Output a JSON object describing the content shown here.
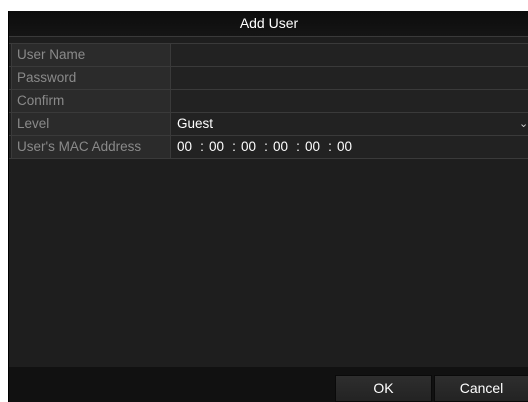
{
  "dialog": {
    "title": "Add User"
  },
  "form": {
    "user_name": {
      "label": "User Name",
      "value": ""
    },
    "password": {
      "label": "Password",
      "value": ""
    },
    "confirm": {
      "label": "Confirm",
      "value": ""
    },
    "level": {
      "label": "Level",
      "value": "Guest"
    },
    "mac": {
      "label": "User's MAC Address",
      "segments": [
        "00",
        "00",
        "00",
        "00",
        "00",
        "00"
      ],
      "separator": ":"
    }
  },
  "buttons": {
    "ok": "OK",
    "cancel": "Cancel"
  },
  "colors": {
    "panel": "#1e1e1e",
    "title_bar": "#0c0c0c",
    "label_text": "#8a8a8a",
    "value_text": "#ffffff"
  }
}
